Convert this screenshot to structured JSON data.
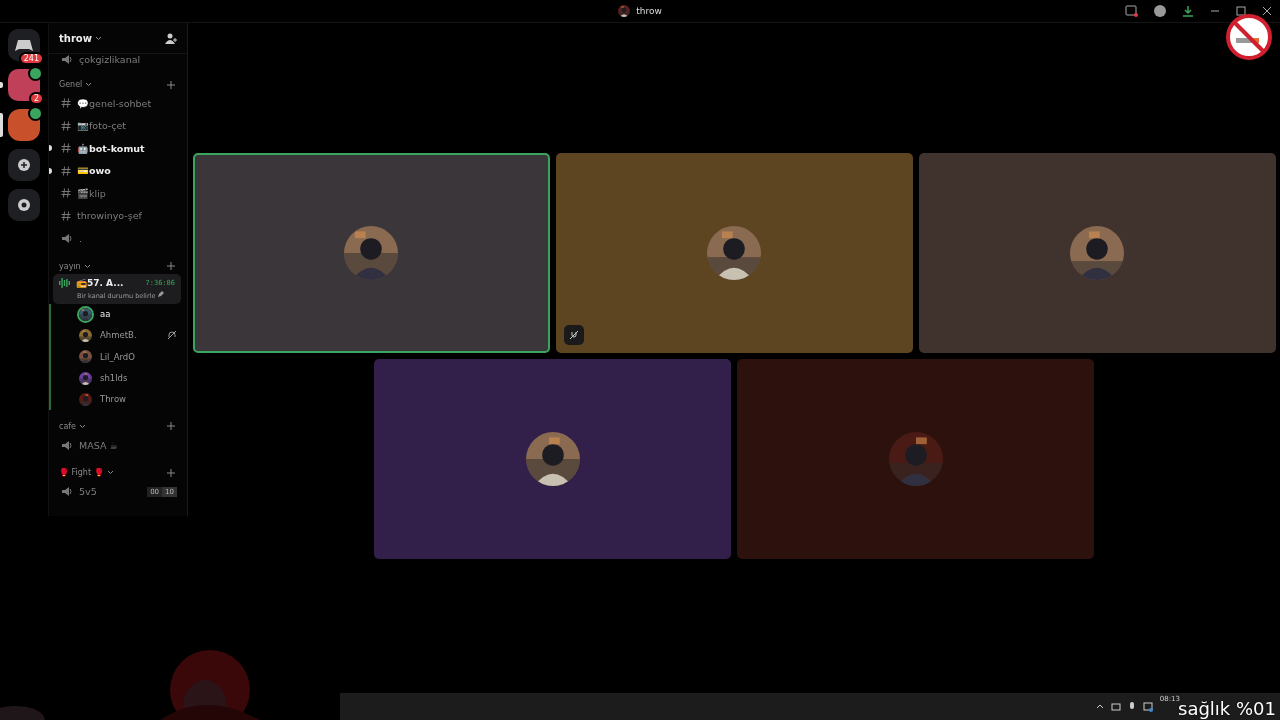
{
  "title_bar": {
    "title": "throw"
  },
  "server_rail": {
    "home_badge": "241",
    "servers": [
      {
        "selected": false,
        "badge": "2",
        "voice": true,
        "color": "#c0405a"
      },
      {
        "selected": true,
        "voice": true,
        "color": "#c8502a"
      }
    ]
  },
  "server_header": {
    "name": "throw"
  },
  "categories": [
    {
      "channels": [
        {
          "kind": "voice",
          "name": "çokgizlikanal",
          "unread": false
        }
      ]
    },
    {
      "name": "Genel",
      "channels": [
        {
          "kind": "text",
          "name": "💬genel-sohbet",
          "unread": false
        },
        {
          "kind": "text",
          "name": "📷foto-çet",
          "unread": false
        },
        {
          "kind": "text",
          "name": "🤖bot-komut",
          "unread": true
        },
        {
          "kind": "text",
          "name": "💳owo",
          "unread": true
        },
        {
          "kind": "text",
          "name": "🎬klip",
          "unread": false
        },
        {
          "kind": "text",
          "name": "throwinyo-şef",
          "unread": false
        },
        {
          "kind": "voice",
          "name": ".",
          "unread": false
        }
      ]
    },
    {
      "name": "yayın",
      "channels": [
        {
          "kind": "live_voice",
          "name": "📻57. A...",
          "time": "7:36:06",
          "status": "Bir kanal durumu belirle",
          "members": [
            {
              "name": "aa",
              "speaking": true,
              "deafened": false
            },
            {
              "name": "AhmetB.",
              "speaking": false,
              "deafened": true
            },
            {
              "name": "Lil_ArdO",
              "speaking": false,
              "deafened": false
            },
            {
              "name": "sh1lds",
              "speaking": false,
              "deafened": false
            },
            {
              "name": "Throw",
              "speaking": false,
              "deafened": false
            }
          ]
        }
      ]
    },
    {
      "name": "cafe",
      "channels": [
        {
          "kind": "voice",
          "name": "MASA ☕",
          "unread": false
        }
      ]
    },
    {
      "name": "🥊 Fight 🥊",
      "channels": [
        {
          "kind": "voice",
          "name": "5v5",
          "unread": false,
          "count": "00",
          "limit": "10"
        }
      ]
    }
  ],
  "tiles": [
    {
      "color": "#3b3639",
      "speaking": true,
      "muted": false
    },
    {
      "color": "#5c4520",
      "speaking": false,
      "muted": true
    },
    {
      "color": "#40322c",
      "speaking": false,
      "muted": false
    },
    {
      "color": "#33204a",
      "speaking": false,
      "muted": false
    },
    {
      "color": "#2c110c",
      "speaking": false,
      "muted": false
    }
  ],
  "taskbar": {
    "time": "08:13"
  },
  "overlay": {
    "text": "sağlık %01"
  }
}
